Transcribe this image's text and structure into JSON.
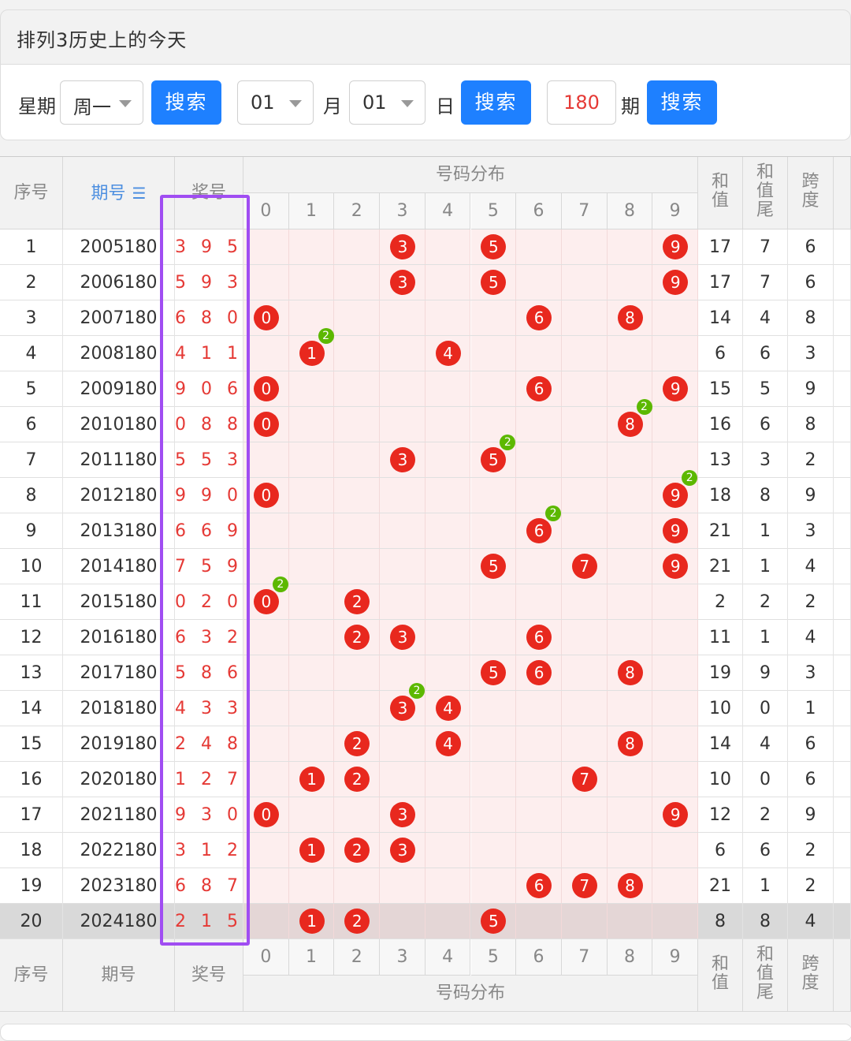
{
  "title": "排列3历史上的今天",
  "filter": {
    "week_label": "星期",
    "week_value": "周一",
    "search_label": "搜索",
    "month_value": "01",
    "month_label": "月",
    "day_value": "01",
    "day_label": "日",
    "issue_value": "180",
    "issue_label": "期"
  },
  "headers": {
    "seq": "序号",
    "issue": "期号",
    "issue_sort_icon": "sort-icon",
    "prize": "奖号",
    "dist": "号码分布",
    "digits": [
      "0",
      "1",
      "2",
      "3",
      "4",
      "5",
      "6",
      "7",
      "8",
      "9"
    ],
    "sum": "和值",
    "sum_tail": "和值尾",
    "span": "跨度"
  },
  "colors": {
    "ball": "#e8281e",
    "repeat_badge": "#5cb800",
    "button": "#1e80ff",
    "highlight_box": "#a04df2"
  },
  "rows": [
    {
      "seq": "1",
      "issue": "2005180",
      "prize": "3 9 5",
      "digits": [
        3,
        9,
        5
      ],
      "repeat": null,
      "sum": "17",
      "tail": "7",
      "span": "6"
    },
    {
      "seq": "2",
      "issue": "2006180",
      "prize": "5 9 3",
      "digits": [
        5,
        9,
        3
      ],
      "repeat": null,
      "sum": "17",
      "tail": "7",
      "span": "6"
    },
    {
      "seq": "3",
      "issue": "2007180",
      "prize": "6 8 0",
      "digits": [
        6,
        8,
        0
      ],
      "repeat": null,
      "sum": "14",
      "tail": "4",
      "span": "8"
    },
    {
      "seq": "4",
      "issue": "2008180",
      "prize": "4 1 1",
      "digits": [
        4,
        1
      ],
      "repeat": 1,
      "sum": "6",
      "tail": "6",
      "span": "3"
    },
    {
      "seq": "5",
      "issue": "2009180",
      "prize": "9 0 6",
      "digits": [
        9,
        0,
        6
      ],
      "repeat": null,
      "sum": "15",
      "tail": "5",
      "span": "9"
    },
    {
      "seq": "6",
      "issue": "2010180",
      "prize": "0 8 8",
      "digits": [
        0,
        8
      ],
      "repeat": 8,
      "sum": "16",
      "tail": "6",
      "span": "8"
    },
    {
      "seq": "7",
      "issue": "2011180",
      "prize": "5 5 3",
      "digits": [
        5,
        3
      ],
      "repeat": 5,
      "sum": "13",
      "tail": "3",
      "span": "2"
    },
    {
      "seq": "8",
      "issue": "2012180",
      "prize": "9 9 0",
      "digits": [
        9,
        0
      ],
      "repeat": 9,
      "sum": "18",
      "tail": "8",
      "span": "9"
    },
    {
      "seq": "9",
      "issue": "2013180",
      "prize": "6 6 9",
      "digits": [
        6,
        9
      ],
      "repeat": 6,
      "sum": "21",
      "tail": "1",
      "span": "3"
    },
    {
      "seq": "10",
      "issue": "2014180",
      "prize": "7 5 9",
      "digits": [
        7,
        5,
        9
      ],
      "repeat": null,
      "sum": "21",
      "tail": "1",
      "span": "4"
    },
    {
      "seq": "11",
      "issue": "2015180",
      "prize": "0 2 0",
      "digits": [
        0,
        2
      ],
      "repeat": 0,
      "sum": "2",
      "tail": "2",
      "span": "2"
    },
    {
      "seq": "12",
      "issue": "2016180",
      "prize": "6 3 2",
      "digits": [
        6,
        3,
        2
      ],
      "repeat": null,
      "sum": "11",
      "tail": "1",
      "span": "4"
    },
    {
      "seq": "13",
      "issue": "2017180",
      "prize": "5 8 6",
      "digits": [
        5,
        8,
        6
      ],
      "repeat": null,
      "sum": "19",
      "tail": "9",
      "span": "3"
    },
    {
      "seq": "14",
      "issue": "2018180",
      "prize": "4 3 3",
      "digits": [
        4,
        3
      ],
      "repeat": 3,
      "sum": "10",
      "tail": "0",
      "span": "1"
    },
    {
      "seq": "15",
      "issue": "2019180",
      "prize": "2 4 8",
      "digits": [
        2,
        4,
        8
      ],
      "repeat": null,
      "sum": "14",
      "tail": "4",
      "span": "6"
    },
    {
      "seq": "16",
      "issue": "2020180",
      "prize": "1 2 7",
      "digits": [
        1,
        2,
        7
      ],
      "repeat": null,
      "sum": "10",
      "tail": "0",
      "span": "6"
    },
    {
      "seq": "17",
      "issue": "2021180",
      "prize": "9 3 0",
      "digits": [
        9,
        3,
        0
      ],
      "repeat": null,
      "sum": "12",
      "tail": "2",
      "span": "9"
    },
    {
      "seq": "18",
      "issue": "2022180",
      "prize": "3 1 2",
      "digits": [
        3,
        1,
        2
      ],
      "repeat": null,
      "sum": "6",
      "tail": "6",
      "span": "2"
    },
    {
      "seq": "19",
      "issue": "2023180",
      "prize": "6 8 7",
      "digits": [
        6,
        8,
        7
      ],
      "repeat": null,
      "sum": "21",
      "tail": "1",
      "span": "2"
    },
    {
      "seq": "20",
      "issue": "2024180",
      "prize": "2 1 5",
      "digits": [
        2,
        1,
        5
      ],
      "repeat": null,
      "sum": "8",
      "tail": "8",
      "span": "4"
    }
  ],
  "repeat_badge_text": "2"
}
